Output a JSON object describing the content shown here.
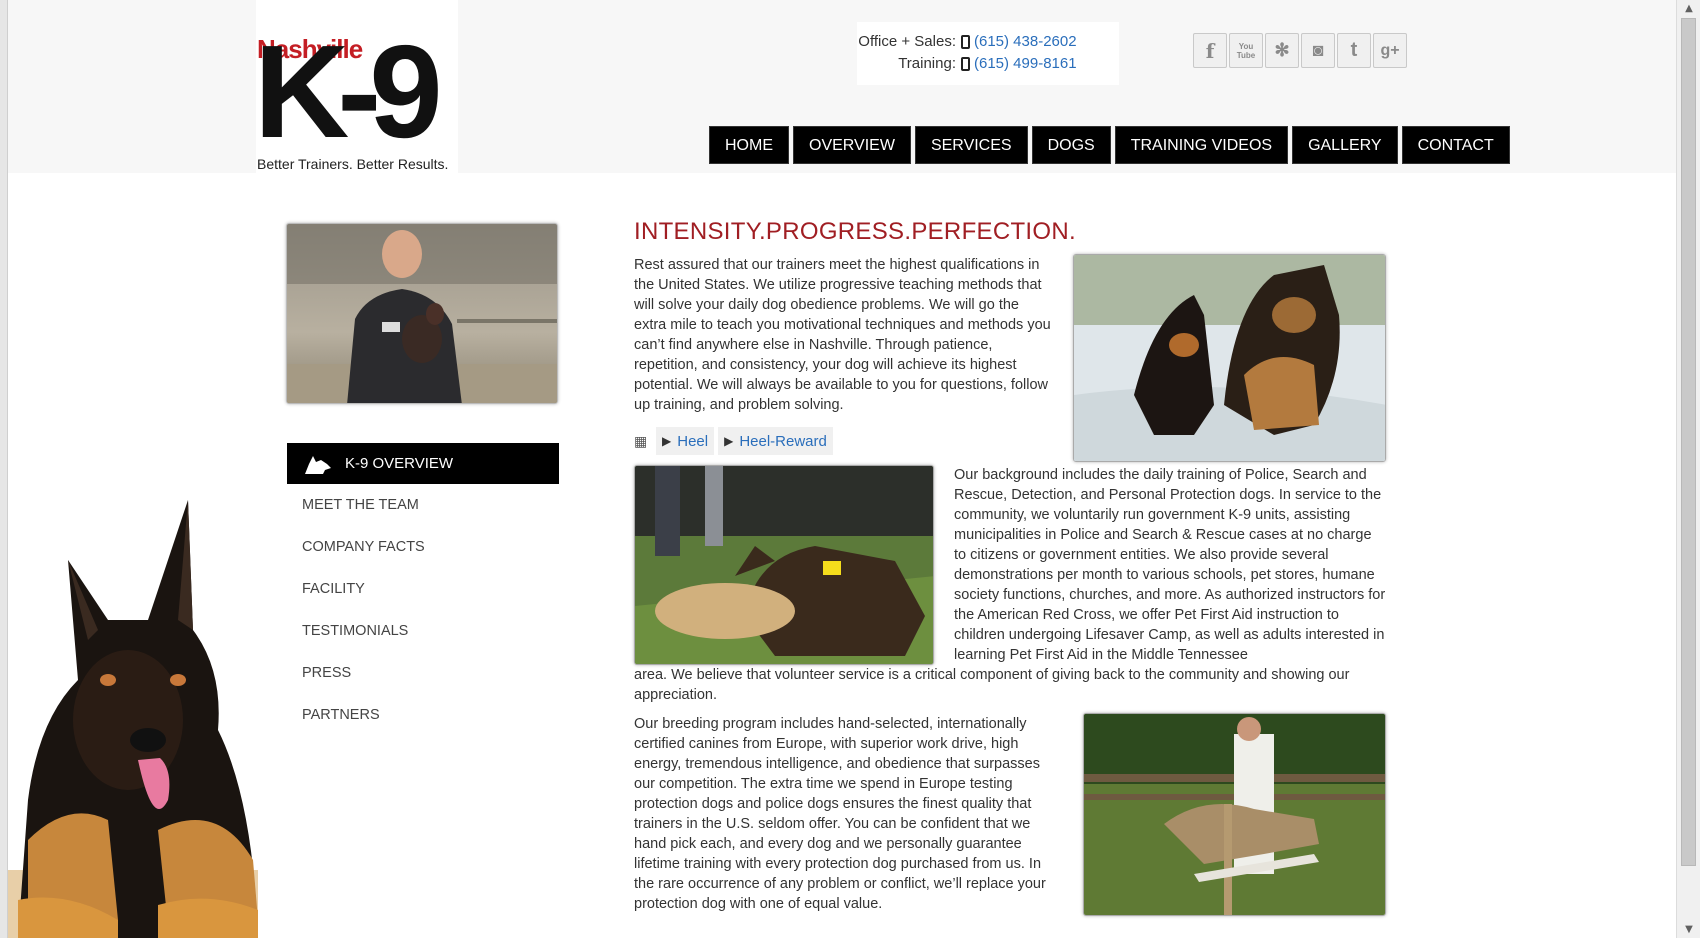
{
  "logo": {
    "name_text": "Nashville",
    "mark_text": "K-9",
    "tagline": "Better Trainers. Better Results."
  },
  "contact": {
    "office_label": "Office + Sales:",
    "office_phone": "(615) 438-2602",
    "training_label": "Training:",
    "training_phone": "(615) 499-8161"
  },
  "social": [
    {
      "icon": "facebook-icon",
      "glyph": "f"
    },
    {
      "icon": "youtube-icon",
      "glyph": "You Tube"
    },
    {
      "icon": "yelp-icon",
      "glyph": "✻"
    },
    {
      "icon": "instagram-icon",
      "glyph": "◙"
    },
    {
      "icon": "twitter-icon",
      "glyph": "t"
    },
    {
      "icon": "google-plus-icon",
      "glyph": "g+"
    }
  ],
  "nav": [
    "HOME",
    "OVERVIEW",
    "SERVICES",
    "DOGS",
    "TRAINING VIDEOS",
    "GALLERY",
    "CONTACT"
  ],
  "sidebar": {
    "active": "K-9 OVERVIEW",
    "items": [
      "MEET THE TEAM",
      "COMPANY FACTS",
      "FACILITY",
      "TESTIMONIALS",
      "PRESS",
      "PARTNERS"
    ]
  },
  "content": {
    "headline": "INTENSITY.PROGRESS.PERFECTION.",
    "para1": "Rest assured that our trainers meet the highest qualifications in the United States. We utilize progressive teaching methods that will solve your daily dog obedience problems. We will go the extra mile to teach you motivational techniques and methods you can’t find anywhere else in Nashville. Through patience, repetition, and consistency, your dog will achieve its highest potential. We will always be available to you for questions, follow up training, and problem solving.",
    "videos": [
      "Heel",
      "Heel-Reward"
    ],
    "para2a": "Our background includes the daily training of Police, Search and Rescue, Detection, and Personal Protection dogs. In service to the community, we voluntarily run government K-9 units, assisting municipalities in Police and Search & Rescue cases at no charge to citizens or government entities. We also provide several demonstrations per month to various schools, pet stores, humane society functions, churches, and more. As authorized instructors for the American Red Cross, we offer Pet First Aid instruction to children undergoing Lifesaver Camp, as well as adults interested in learning Pet First Aid in the Middle Tennessee",
    "para2b": "area. We believe that volunteer service is a critical component of giving back to the community and showing our appreciation.",
    "para3": "Our breeding program includes hand-selected, internationally certified canines from Europe, with superior work drive, high energy, tremendous intelligence, and obedience that surpasses our competition. The extra time we spend in Europe testing protection dogs and police dogs ensures the finest quality that trainers in the U.S. seldom offer. You can be confident that we hand pick each, and every dog and we personally guarantee lifetime training with every protection dog purchased from us. In the rare occurrence of any problem or conflict, we’ll replace your protection dog with one of equal value."
  },
  "colors": {
    "brand_red": "#a01e23",
    "link_blue": "#2a6ebb",
    "nav_bg": "#000000"
  }
}
